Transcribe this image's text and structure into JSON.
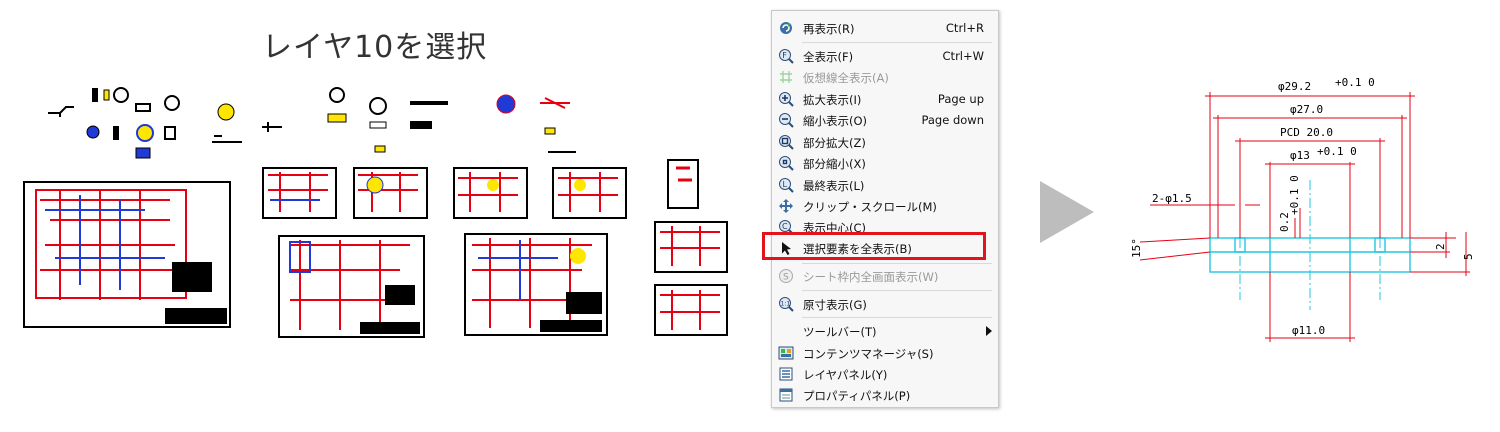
{
  "caption": "レイヤ10を選択",
  "menu": {
    "items": [
      {
        "label": "再表示(R)",
        "shortcut": "Ctrl+R",
        "icon": "refresh-icon",
        "disabled": false
      },
      {
        "label": "全表示(F)",
        "shortcut": "Ctrl+W",
        "icon": "fit-all-icon",
        "disabled": false
      },
      {
        "label": "仮想線全表示(A)",
        "shortcut": "",
        "icon": "virtual-line-icon",
        "disabled": true
      },
      {
        "label": "拡大表示(I)",
        "shortcut": "Page up",
        "icon": "zoom-in-icon",
        "disabled": false
      },
      {
        "label": "縮小表示(O)",
        "shortcut": "Page down",
        "icon": "zoom-out-icon",
        "disabled": false
      },
      {
        "label": "部分拡大(Z)",
        "shortcut": "",
        "icon": "partial-zoom-in-icon",
        "disabled": false
      },
      {
        "label": "部分縮小(X)",
        "shortcut": "",
        "icon": "partial-zoom-out-icon",
        "disabled": false
      },
      {
        "label": "最終表示(L)",
        "shortcut": "",
        "icon": "last-view-icon",
        "disabled": false
      },
      {
        "label": "クリップ・スクロール(M)",
        "shortcut": "",
        "icon": "clip-scroll-icon",
        "disabled": false
      },
      {
        "label": "表示中心(C)",
        "shortcut": "",
        "icon": "view-center-icon",
        "disabled": false
      },
      {
        "label": "選択要素を全表示(B)",
        "shortcut": "",
        "icon": "select-fit-icon",
        "disabled": false
      },
      {
        "label": "シート枠内全画面表示(W)",
        "shortcut": "",
        "icon": "sheet-frame-icon",
        "disabled": true
      },
      {
        "label": "原寸表示(G)",
        "shortcut": "",
        "icon": "actual-size-icon",
        "disabled": false
      },
      {
        "label": "ツールバー(T)",
        "shortcut": "",
        "icon": "",
        "disabled": false
      },
      {
        "label": "コンテンツマネージャ(S)",
        "shortcut": "",
        "icon": "content-manager-icon",
        "disabled": false
      },
      {
        "label": "レイヤパネル(Y)",
        "shortcut": "",
        "icon": "layer-panel-icon",
        "disabled": false
      },
      {
        "label": "プロパティパネル(P)",
        "shortcut": "",
        "icon": "property-panel-icon",
        "disabled": false
      }
    ]
  },
  "detail": {
    "d1": "φ29.2",
    "d1_tol": "+0.1 0",
    "d2": "φ27.0",
    "pcd": "PCD 20.0",
    "d3": "φ13",
    "d3_tol": "+0.1 0",
    "holes": "2-φ1.5",
    "depth": "0.2",
    "depth_tol": "+0.1 0",
    "angle": "15°",
    "h1": "2",
    "h2": "5",
    "d4": "φ11.0"
  },
  "colors": {
    "highlight": "#e0141a",
    "drawing_red": "#e60012",
    "drawing_blue": "#1f3ad6",
    "drawing_yellow": "#ffe600",
    "part_cyan": "#22c7e0",
    "arrow_gray": "#bdbdbd"
  }
}
